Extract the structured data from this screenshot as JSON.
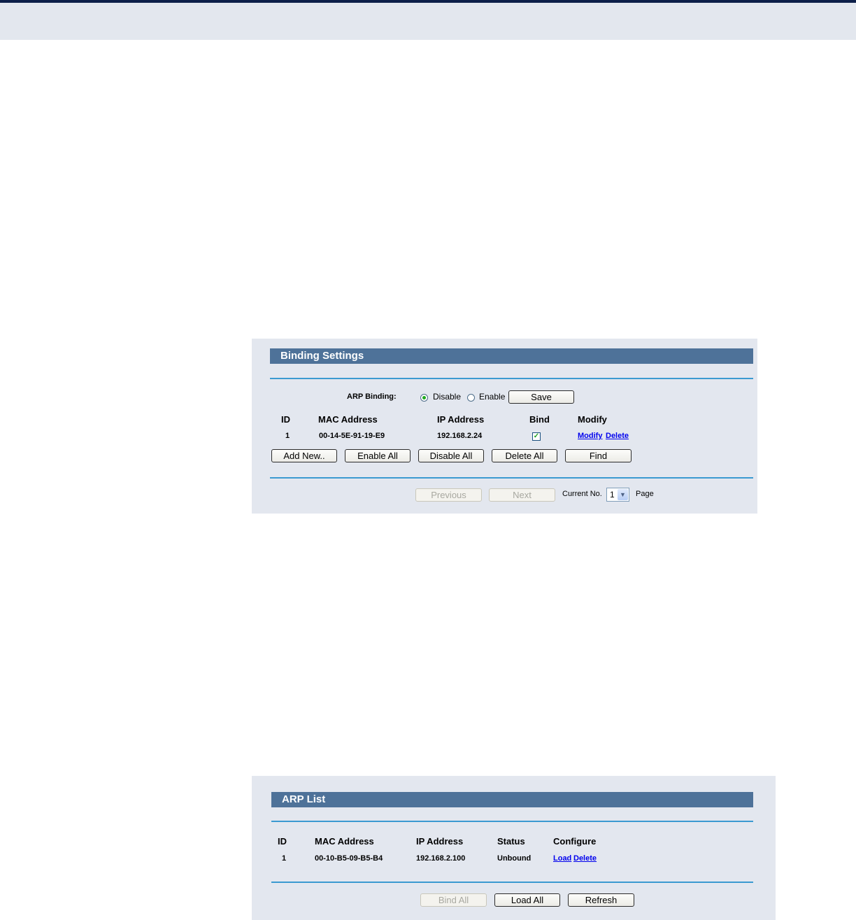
{
  "binding_settings": {
    "title": "Binding Settings",
    "arp_binding_label": "ARP Binding:",
    "disable_label": "Disable",
    "enable_label": "Enable",
    "selected_option": "Disable",
    "save_label": "Save",
    "columns": [
      "ID",
      "MAC Address",
      "IP Address",
      "Bind",
      "Modify"
    ],
    "rows": [
      {
        "id": "1",
        "mac": "00-14-5E-91-19-E9",
        "ip": "192.168.2.24",
        "bind": true,
        "modify_link": "Modify",
        "delete_link": "Delete"
      }
    ],
    "buttons": {
      "add_new": "Add New..",
      "enable_all": "Enable All",
      "disable_all": "Disable All",
      "delete_all": "Delete All",
      "find": "Find"
    },
    "pagination": {
      "previous": "Previous",
      "next": "Next",
      "current_no_label": "Current No.",
      "current_page": "1",
      "page_label": "Page"
    }
  },
  "arp_list": {
    "title": "ARP List",
    "columns": [
      "ID",
      "MAC Address",
      "IP Address",
      "Status",
      "Configure"
    ],
    "rows": [
      {
        "id": "1",
        "mac": "00-10-B5-09-B5-B4",
        "ip": "192.168.2.100",
        "status": "Unbound",
        "load_link": "Load",
        "delete_link": "Delete"
      }
    ],
    "buttons": {
      "bind_all": "Bind All",
      "load_all": "Load All",
      "refresh": "Refresh"
    }
  }
}
